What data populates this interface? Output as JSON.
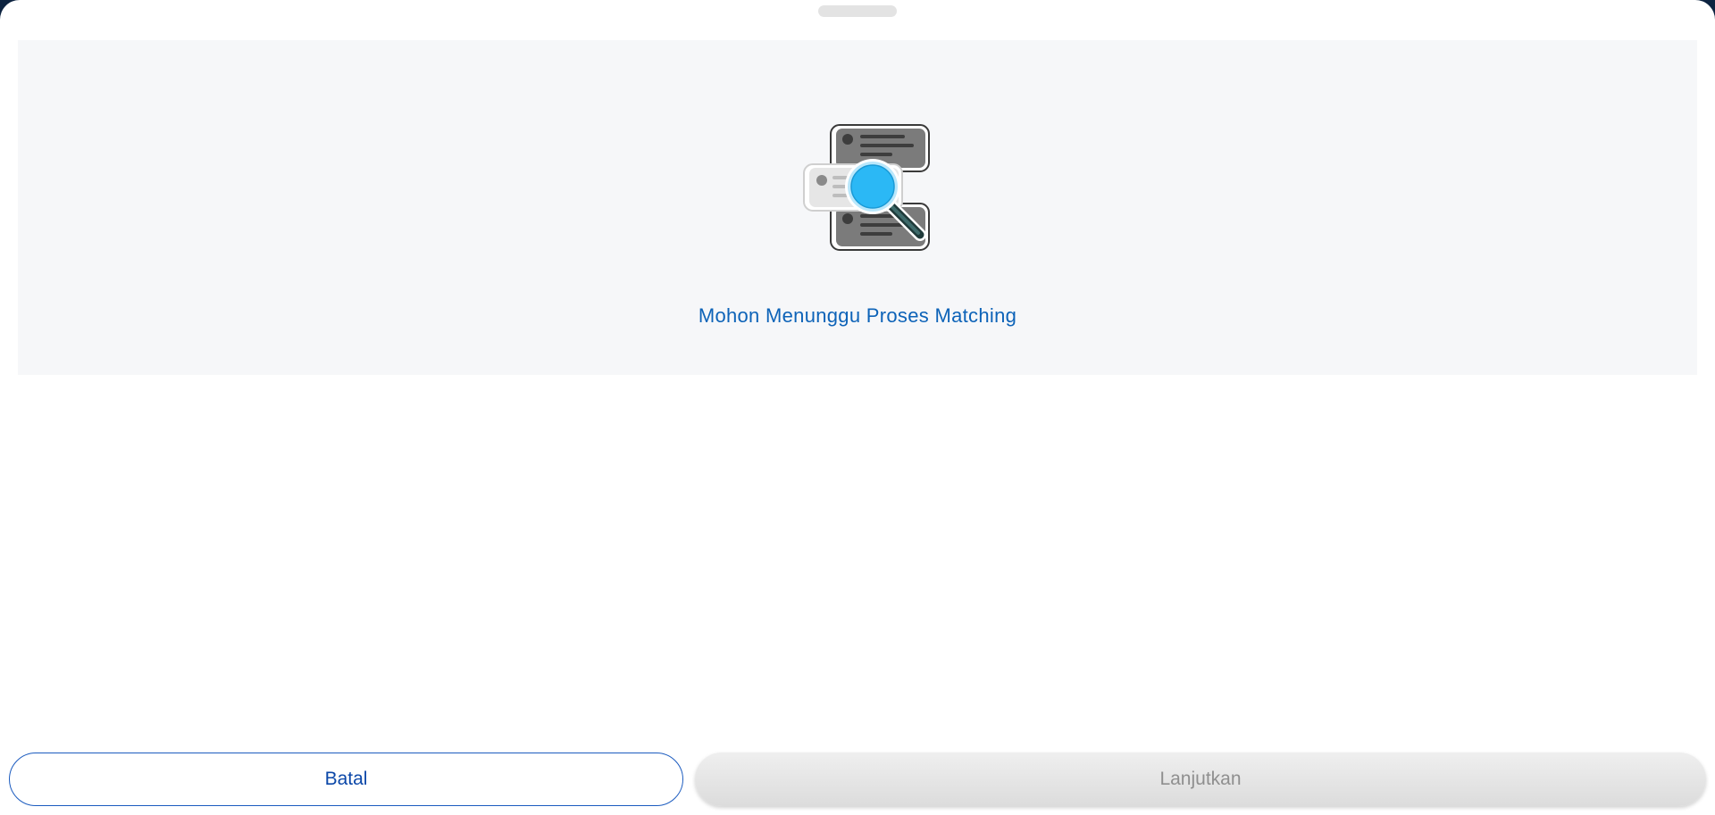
{
  "status": {
    "message": "Mohon Menunggu Proses Matching",
    "icon": "document-search-icon"
  },
  "actions": {
    "cancel_label": "Batal",
    "continue_label": "Lanjutkan",
    "continue_enabled": false
  },
  "colors": {
    "accent": "#0d63b8",
    "cancel_border": "#1b5bbf",
    "disabled_text": "#8f8f8f",
    "panel_bg": "#f6f7f9",
    "magnifier_lens": "#2bb8f5"
  }
}
